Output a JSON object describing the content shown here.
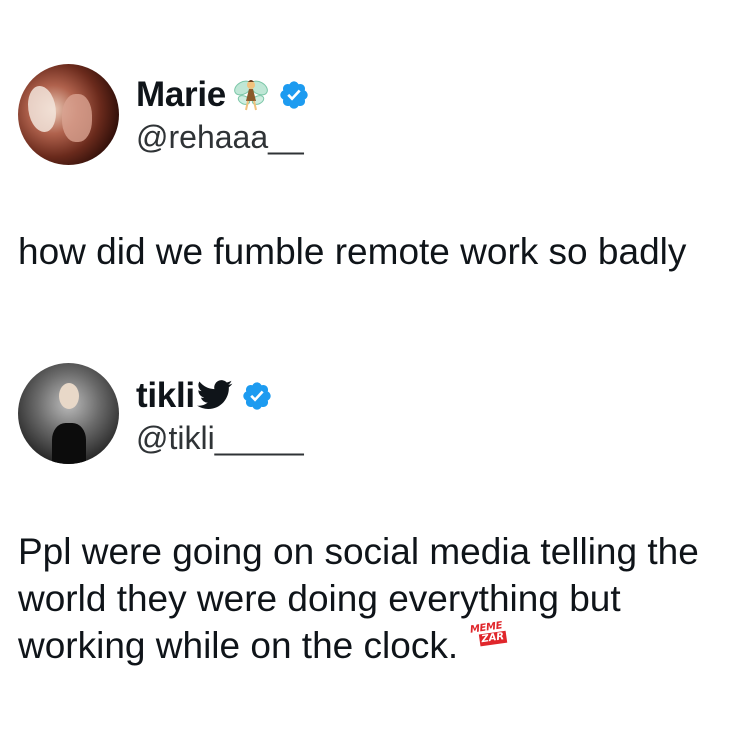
{
  "tweets": [
    {
      "display_name": "Marie",
      "name_emoji": "fairy-icon",
      "verified": true,
      "handle": "@rehaaa__",
      "text": "how did we fumble remote work so badly"
    },
    {
      "display_name": "tikli",
      "name_emoji": "bird-icon",
      "verified": true,
      "handle": "@tikli_____",
      "text": "Ppl were going on social media telling the world they were doing everything but working while on the clock."
    }
  ],
  "watermark": {
    "line1": "MEME",
    "line2": "ZAR"
  },
  "colors": {
    "verified": "#1d9bf0",
    "text": "#0f1419",
    "handle": "#2f3336",
    "watermark": "#e0262b"
  }
}
